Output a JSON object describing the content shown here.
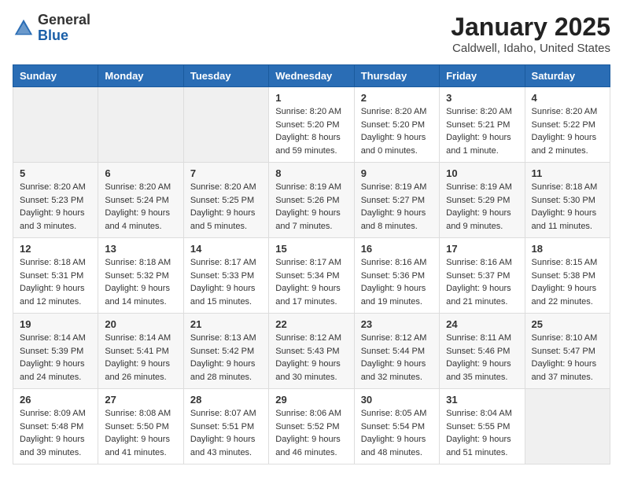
{
  "header": {
    "logo_general": "General",
    "logo_blue": "Blue",
    "title": "January 2025",
    "subtitle": "Caldwell, Idaho, United States"
  },
  "weekdays": [
    "Sunday",
    "Monday",
    "Tuesday",
    "Wednesday",
    "Thursday",
    "Friday",
    "Saturday"
  ],
  "weeks": [
    [
      {
        "day": "",
        "sunrise": "",
        "sunset": "",
        "daylight": ""
      },
      {
        "day": "",
        "sunrise": "",
        "sunset": "",
        "daylight": ""
      },
      {
        "day": "",
        "sunrise": "",
        "sunset": "",
        "daylight": ""
      },
      {
        "day": "1",
        "sunrise": "Sunrise: 8:20 AM",
        "sunset": "Sunset: 5:20 PM",
        "daylight": "Daylight: 8 hours and 59 minutes."
      },
      {
        "day": "2",
        "sunrise": "Sunrise: 8:20 AM",
        "sunset": "Sunset: 5:20 PM",
        "daylight": "Daylight: 9 hours and 0 minutes."
      },
      {
        "day": "3",
        "sunrise": "Sunrise: 8:20 AM",
        "sunset": "Sunset: 5:21 PM",
        "daylight": "Daylight: 9 hours and 1 minute."
      },
      {
        "day": "4",
        "sunrise": "Sunrise: 8:20 AM",
        "sunset": "Sunset: 5:22 PM",
        "daylight": "Daylight: 9 hours and 2 minutes."
      }
    ],
    [
      {
        "day": "5",
        "sunrise": "Sunrise: 8:20 AM",
        "sunset": "Sunset: 5:23 PM",
        "daylight": "Daylight: 9 hours and 3 minutes."
      },
      {
        "day": "6",
        "sunrise": "Sunrise: 8:20 AM",
        "sunset": "Sunset: 5:24 PM",
        "daylight": "Daylight: 9 hours and 4 minutes."
      },
      {
        "day": "7",
        "sunrise": "Sunrise: 8:20 AM",
        "sunset": "Sunset: 5:25 PM",
        "daylight": "Daylight: 9 hours and 5 minutes."
      },
      {
        "day": "8",
        "sunrise": "Sunrise: 8:19 AM",
        "sunset": "Sunset: 5:26 PM",
        "daylight": "Daylight: 9 hours and 7 minutes."
      },
      {
        "day": "9",
        "sunrise": "Sunrise: 8:19 AM",
        "sunset": "Sunset: 5:27 PM",
        "daylight": "Daylight: 9 hours and 8 minutes."
      },
      {
        "day": "10",
        "sunrise": "Sunrise: 8:19 AM",
        "sunset": "Sunset: 5:29 PM",
        "daylight": "Daylight: 9 hours and 9 minutes."
      },
      {
        "day": "11",
        "sunrise": "Sunrise: 8:18 AM",
        "sunset": "Sunset: 5:30 PM",
        "daylight": "Daylight: 9 hours and 11 minutes."
      }
    ],
    [
      {
        "day": "12",
        "sunrise": "Sunrise: 8:18 AM",
        "sunset": "Sunset: 5:31 PM",
        "daylight": "Daylight: 9 hours and 12 minutes."
      },
      {
        "day": "13",
        "sunrise": "Sunrise: 8:18 AM",
        "sunset": "Sunset: 5:32 PM",
        "daylight": "Daylight: 9 hours and 14 minutes."
      },
      {
        "day": "14",
        "sunrise": "Sunrise: 8:17 AM",
        "sunset": "Sunset: 5:33 PM",
        "daylight": "Daylight: 9 hours and 15 minutes."
      },
      {
        "day": "15",
        "sunrise": "Sunrise: 8:17 AM",
        "sunset": "Sunset: 5:34 PM",
        "daylight": "Daylight: 9 hours and 17 minutes."
      },
      {
        "day": "16",
        "sunrise": "Sunrise: 8:16 AM",
        "sunset": "Sunset: 5:36 PM",
        "daylight": "Daylight: 9 hours and 19 minutes."
      },
      {
        "day": "17",
        "sunrise": "Sunrise: 8:16 AM",
        "sunset": "Sunset: 5:37 PM",
        "daylight": "Daylight: 9 hours and 21 minutes."
      },
      {
        "day": "18",
        "sunrise": "Sunrise: 8:15 AM",
        "sunset": "Sunset: 5:38 PM",
        "daylight": "Daylight: 9 hours and 22 minutes."
      }
    ],
    [
      {
        "day": "19",
        "sunrise": "Sunrise: 8:14 AM",
        "sunset": "Sunset: 5:39 PM",
        "daylight": "Daylight: 9 hours and 24 minutes."
      },
      {
        "day": "20",
        "sunrise": "Sunrise: 8:14 AM",
        "sunset": "Sunset: 5:41 PM",
        "daylight": "Daylight: 9 hours and 26 minutes."
      },
      {
        "day": "21",
        "sunrise": "Sunrise: 8:13 AM",
        "sunset": "Sunset: 5:42 PM",
        "daylight": "Daylight: 9 hours and 28 minutes."
      },
      {
        "day": "22",
        "sunrise": "Sunrise: 8:12 AM",
        "sunset": "Sunset: 5:43 PM",
        "daylight": "Daylight: 9 hours and 30 minutes."
      },
      {
        "day": "23",
        "sunrise": "Sunrise: 8:12 AM",
        "sunset": "Sunset: 5:44 PM",
        "daylight": "Daylight: 9 hours and 32 minutes."
      },
      {
        "day": "24",
        "sunrise": "Sunrise: 8:11 AM",
        "sunset": "Sunset: 5:46 PM",
        "daylight": "Daylight: 9 hours and 35 minutes."
      },
      {
        "day": "25",
        "sunrise": "Sunrise: 8:10 AM",
        "sunset": "Sunset: 5:47 PM",
        "daylight": "Daylight: 9 hours and 37 minutes."
      }
    ],
    [
      {
        "day": "26",
        "sunrise": "Sunrise: 8:09 AM",
        "sunset": "Sunset: 5:48 PM",
        "daylight": "Daylight: 9 hours and 39 minutes."
      },
      {
        "day": "27",
        "sunrise": "Sunrise: 8:08 AM",
        "sunset": "Sunset: 5:50 PM",
        "daylight": "Daylight: 9 hours and 41 minutes."
      },
      {
        "day": "28",
        "sunrise": "Sunrise: 8:07 AM",
        "sunset": "Sunset: 5:51 PM",
        "daylight": "Daylight: 9 hours and 43 minutes."
      },
      {
        "day": "29",
        "sunrise": "Sunrise: 8:06 AM",
        "sunset": "Sunset: 5:52 PM",
        "daylight": "Daylight: 9 hours and 46 minutes."
      },
      {
        "day": "30",
        "sunrise": "Sunrise: 8:05 AM",
        "sunset": "Sunset: 5:54 PM",
        "daylight": "Daylight: 9 hours and 48 minutes."
      },
      {
        "day": "31",
        "sunrise": "Sunrise: 8:04 AM",
        "sunset": "Sunset: 5:55 PM",
        "daylight": "Daylight: 9 hours and 51 minutes."
      },
      {
        "day": "",
        "sunrise": "",
        "sunset": "",
        "daylight": ""
      }
    ]
  ]
}
